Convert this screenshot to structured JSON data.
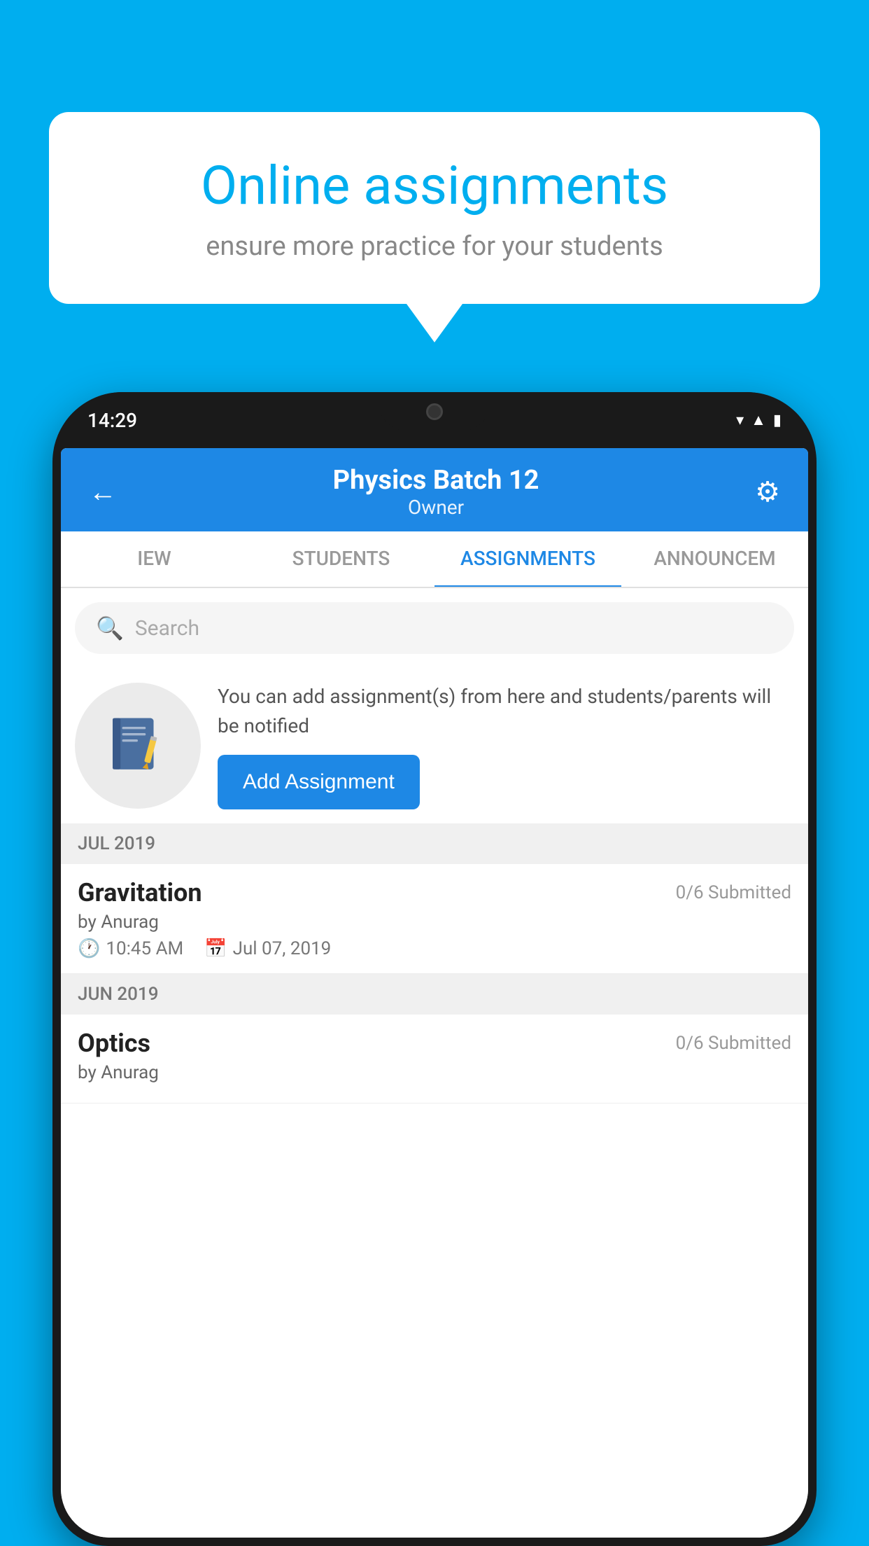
{
  "background": {
    "color": "#00AEEF"
  },
  "speech_bubble": {
    "title": "Online assignments",
    "subtitle": "ensure more practice for your students"
  },
  "phone": {
    "status_bar": {
      "time": "14:29",
      "icons": [
        "wifi",
        "signal",
        "battery"
      ]
    },
    "header": {
      "title": "Physics Batch 12",
      "subtitle": "Owner",
      "back_label": "←",
      "settings_label": "⚙"
    },
    "tabs": [
      {
        "label": "IEW",
        "active": false
      },
      {
        "label": "STUDENTS",
        "active": false
      },
      {
        "label": "ASSIGNMENTS",
        "active": true
      },
      {
        "label": "ANNOUNCEM",
        "active": false
      }
    ],
    "search": {
      "placeholder": "Search"
    },
    "empty_state": {
      "description": "You can add assignment(s) from here and students/parents will be notified",
      "button_label": "Add Assignment"
    },
    "sections": [
      {
        "header": "JUL 2019",
        "assignments": [
          {
            "title": "Gravitation",
            "submitted": "0/6 Submitted",
            "author": "by Anurag",
            "time": "10:45 AM",
            "date": "Jul 07, 2019"
          }
        ]
      },
      {
        "header": "JUN 2019",
        "assignments": [
          {
            "title": "Optics",
            "submitted": "0/6 Submitted",
            "author": "by Anurag",
            "time": "",
            "date": ""
          }
        ]
      }
    ]
  }
}
